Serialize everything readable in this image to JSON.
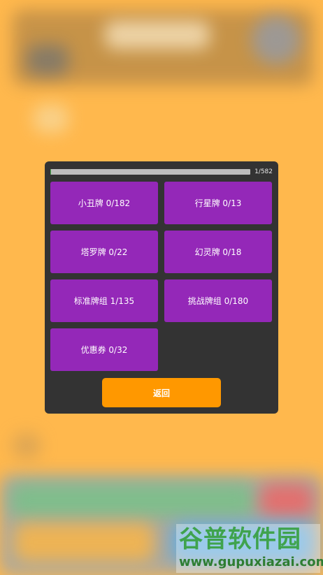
{
  "dialog": {
    "progress": {
      "text": "1/582",
      "value": 1,
      "max": 582
    },
    "collections": [
      {
        "label": "小丑牌 0/182"
      },
      {
        "label": "行星牌 0/13"
      },
      {
        "label": "塔罗牌 0/22"
      },
      {
        "label": "幻灵牌 0/18"
      },
      {
        "label": "标准牌组 1/135"
      },
      {
        "label": "挑战牌组 0/180"
      },
      {
        "label": "优惠券 0/32"
      }
    ],
    "back_label": "返回"
  },
  "watermark": {
    "title": "谷普软件园",
    "url": "www.gupuxiazai.com"
  },
  "colors": {
    "background": "#FFB84D",
    "dialog": "#333333",
    "card": "#9428B8",
    "back_button": "#FF9800",
    "progress_track": "#BDBDBD"
  }
}
